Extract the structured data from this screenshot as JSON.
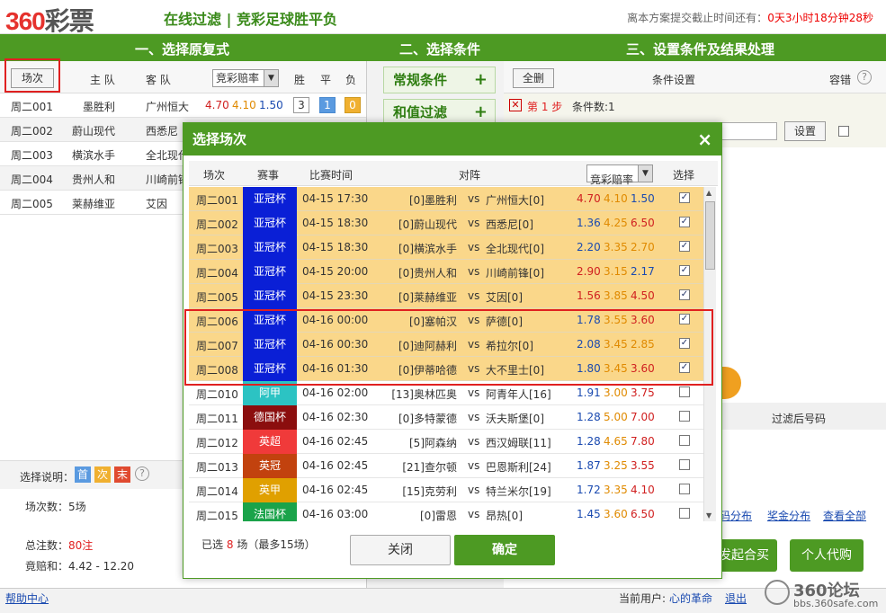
{
  "header": {
    "logo_num": "360",
    "logo_text": "彩票",
    "subtitle": "在线过滤 | 竞彩足球胜平负",
    "deadline_label": "离本方案提交截止时间还有：",
    "deadline_value": "0天3小时18分钟28秒"
  },
  "steps": [
    "一、选择原复式",
    "二、选择条件",
    "三、设置条件及结果处理"
  ],
  "left": {
    "headers": {
      "match": "场次",
      "home": "主 队",
      "away": "客 队",
      "odds_select": "竞彩赔率",
      "win": "胜",
      "draw": "平",
      "lose": "负"
    },
    "rows": [
      {
        "no": "周二001",
        "home": "墨胜利",
        "away": "广州恒大",
        "o1": "4.70",
        "o2": "4.10",
        "o3": "1.50",
        "b1": "3",
        "b2": "1",
        "b3": "0"
      },
      {
        "no": "周二002",
        "home": "蔚山现代",
        "away": "西悉尼"
      },
      {
        "no": "周二003",
        "home": "横滨水手",
        "away": "全北现代"
      },
      {
        "no": "周二004",
        "home": "贵州人和",
        "away": "川崎前锋"
      },
      {
        "no": "周二005",
        "home": "莱赫维亚",
        "away": "艾因"
      }
    ],
    "legend_label": "选择说明：",
    "legend": [
      "首",
      "次",
      "末"
    ],
    "count_label": "场次数：5场",
    "bets_label": "总注数：",
    "bets_value": "80注",
    "bonus_label": "竟赔和：4.42 - 12.20",
    "help": "帮助中心"
  },
  "middle": {
    "normal": "常规条件",
    "sum": "和值过滤"
  },
  "right": {
    "delete_all": "全删",
    "settings": "条件设置",
    "tolerance": "容错",
    "step_label": "第 1 步",
    "cond_count": "条件数:1",
    "input_placeholder": "条件",
    "set_button": "设置",
    "filtered_label": "过滤后号码",
    "links": [
      "码分布",
      "奖金分布",
      "查看全部"
    ],
    "launch": "发起合买",
    "personal": "个人代购"
  },
  "footer": {
    "user_label": "当前用户:",
    "user": "心的革命",
    "logout": "退出",
    "watermark": "360论坛",
    "watermark_url": "bbs.360safe.com"
  },
  "modal": {
    "title": "选择场次",
    "headers": {
      "no": "场次",
      "event": "赛事",
      "time": "比赛时间",
      "match": "对阵",
      "odds": "竞彩赔率",
      "pick": "选择"
    },
    "rows": [
      {
        "no": "周二001",
        "event": "亚冠杯",
        "color": "#0a1fd6",
        "time": "04-15 17:30",
        "home": "[0]墨胜利",
        "vs": "vs",
        "away": "广州恒大[0]",
        "o1": "4.70",
        "o2": "4.10",
        "o3": "1.50",
        "sel": true
      },
      {
        "no": "周二002",
        "event": "亚冠杯",
        "color": "#0a1fd6",
        "time": "04-15 18:30",
        "home": "[0]蔚山现代",
        "vs": "vs",
        "away": "西悉尼[0]",
        "o1": "1.36",
        "o2": "4.25",
        "o3": "6.50",
        "sel": true
      },
      {
        "no": "周二003",
        "event": "亚冠杯",
        "color": "#0a1fd6",
        "time": "04-15 18:30",
        "home": "[0]横滨水手",
        "vs": "vs",
        "away": "全北现代[0]",
        "o1": "2.20",
        "o2": "3.35",
        "o3": "2.70",
        "sel": true
      },
      {
        "no": "周二004",
        "event": "亚冠杯",
        "color": "#0a1fd6",
        "time": "04-15 20:00",
        "home": "[0]贵州人和",
        "vs": "vs",
        "away": "川崎前锋[0]",
        "o1": "2.90",
        "o2": "3.15",
        "o3": "2.17",
        "sel": true
      },
      {
        "no": "周二005",
        "event": "亚冠杯",
        "color": "#0a1fd6",
        "time": "04-15 23:30",
        "home": "[0]莱赫维亚",
        "vs": "vs",
        "away": "艾因[0]",
        "o1": "1.56",
        "o2": "3.85",
        "o3": "4.50",
        "sel": true
      },
      {
        "no": "周二006",
        "event": "亚冠杯",
        "color": "#0a1fd6",
        "time": "04-16 00:00",
        "home": "[0]塞帕汉",
        "vs": "vs",
        "away": "萨德[0]",
        "o1": "1.78",
        "o2": "3.55",
        "o3": "3.60",
        "sel": true
      },
      {
        "no": "周二007",
        "event": "亚冠杯",
        "color": "#0a1fd6",
        "time": "04-16 00:30",
        "home": "[0]迪阿赫利",
        "vs": "vs",
        "away": "希拉尔[0]",
        "o1": "2.08",
        "o2": "3.45",
        "o3": "2.85",
        "sel": true
      },
      {
        "no": "周二008",
        "event": "亚冠杯",
        "color": "#0a1fd6",
        "time": "04-16 01:30",
        "home": "[0]伊蒂哈德",
        "vs": "vs",
        "away": "大不里士[0]",
        "o1": "1.80",
        "o2": "3.45",
        "o3": "3.60",
        "sel": true
      },
      {
        "no": "周二010",
        "event": "阿甲",
        "color": "#2cc3c3",
        "time": "04-16 02:00",
        "home": "[13]奥林匹奥",
        "vs": "vs",
        "away": "阿青年人[16]",
        "o1": "1.91",
        "o2": "3.00",
        "o3": "3.75",
        "sel": false
      },
      {
        "no": "周二011",
        "event": "德国杯",
        "color": "#8b0e0e",
        "time": "04-16 02:30",
        "home": "[0]多特蒙德",
        "vs": "vs",
        "away": "沃夫斯堡[0]",
        "o1": "1.28",
        "o2": "5.00",
        "o3": "7.00",
        "sel": false
      },
      {
        "no": "周二012",
        "event": "英超",
        "color": "#f03a3a",
        "time": "04-16 02:45",
        "home": "[5]阿森纳",
        "vs": "vs",
        "away": "西汉姆联[11]",
        "o1": "1.28",
        "o2": "4.65",
        "o3": "7.80",
        "sel": false
      },
      {
        "no": "周二013",
        "event": "英冠",
        "color": "#c2420e",
        "time": "04-16 02:45",
        "home": "[21]查尔顿",
        "vs": "vs",
        "away": "巴恩斯利[24]",
        "o1": "1.87",
        "o2": "3.25",
        "o3": "3.55",
        "sel": false
      },
      {
        "no": "周二014",
        "event": "英甲",
        "color": "#e0a000",
        "time": "04-16 02:45",
        "home": "[15]克劳利",
        "vs": "vs",
        "away": "特兰米尔[19]",
        "o1": "1.72",
        "o2": "3.35",
        "o3": "4.10",
        "sel": false
      },
      {
        "no": "周二015",
        "event": "法国杯",
        "color": "#1aa34a",
        "time": "04-16 03:00",
        "home": "[0]雷恩",
        "vs": "vs",
        "away": "昂热[0]",
        "o1": "1.45",
        "o2": "3.60",
        "o3": "6.50",
        "sel": false
      }
    ],
    "selected_prefix": "已选",
    "selected_count": "8",
    "selected_suffix": "场（最多15场）",
    "close": "关闭",
    "confirm": "确定"
  },
  "colors": {
    "green": "#4d9a23",
    "selected_row": "#fad78a",
    "red": "#e02020"
  }
}
